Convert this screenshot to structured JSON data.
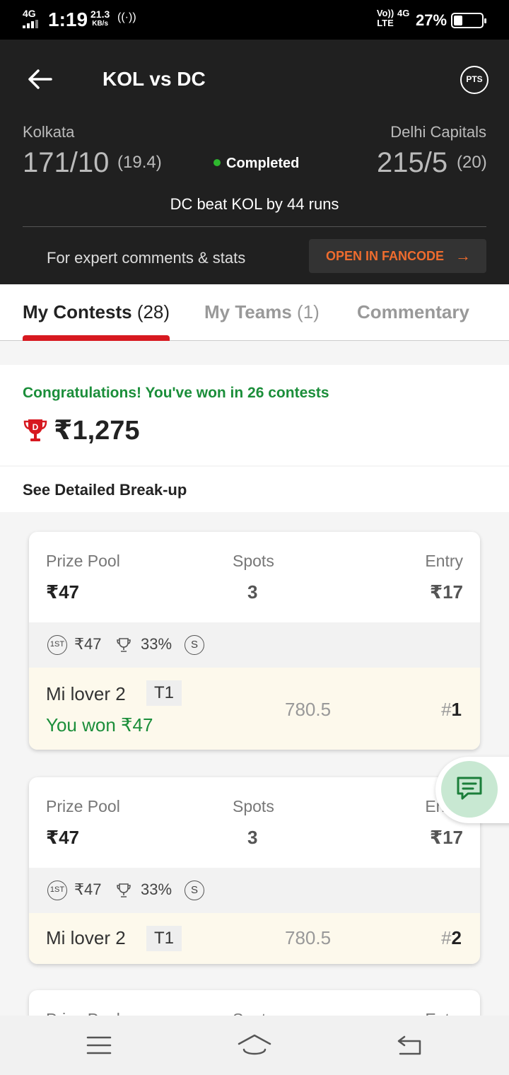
{
  "status_bar": {
    "network": "4G",
    "time": "1:19",
    "speed_value": "21.3",
    "speed_unit": "KB/s",
    "volte": "Vo)) LTE",
    "network_right": "4G",
    "battery": "27%"
  },
  "header": {
    "title": "KOL vs DC",
    "pts_label": "PTS",
    "team1": {
      "name": "Kolkata",
      "score": "171/10",
      "overs": "(19.4)"
    },
    "team2": {
      "name": "Delhi Capitals",
      "score": "215/5",
      "overs": "(20)"
    },
    "status": "Completed",
    "status_color": "#2eb82e",
    "result": "DC beat KOL by 44 runs",
    "expert_text": "For expert comments & stats",
    "fancode_button": "OPEN IN FANCODE",
    "fancode_color": "#ef6c2e"
  },
  "tabs": [
    {
      "label": "My Contests",
      "count": "(28)",
      "active": true
    },
    {
      "label": "My Teams",
      "count": "(1)",
      "active": false
    },
    {
      "label": "Commentary",
      "count": "",
      "active": false
    }
  ],
  "accent_color": "#d71920",
  "winnings": {
    "message": "Congratulations! You've won in 26 contests",
    "amount": "₹1,275",
    "breakup_link": "See Detailed Break-up"
  },
  "contests": [
    {
      "prize_pool_label": "Prize Pool",
      "prize_pool": "₹47",
      "spots_label": "Spots",
      "spots": "3",
      "entry_label": "Entry",
      "entry": "₹17",
      "first_prize": "₹47",
      "win_pct": "33%",
      "team_name": "Mi lover 2",
      "team_tag": "T1",
      "points": "780.5",
      "rank_prefix": "#",
      "rank": "1",
      "won_text": "You won ₹47"
    },
    {
      "prize_pool_label": "Prize Pool",
      "prize_pool": "₹47",
      "spots_label": "Spots",
      "spots": "3",
      "entry_label": "Entry",
      "entry": "₹17",
      "first_prize": "₹47",
      "win_pct": "33%",
      "team_name": "Mi lover 2",
      "team_tag": "T1",
      "points": "780.5",
      "rank_prefix": "#",
      "rank": "2"
    },
    {
      "prize_pool_label": "Prize Pool",
      "spots_label": "Spots",
      "entry_label": "Entry"
    }
  ],
  "nav_icons": [
    "menu-icon",
    "home-icon",
    "back-icon"
  ]
}
